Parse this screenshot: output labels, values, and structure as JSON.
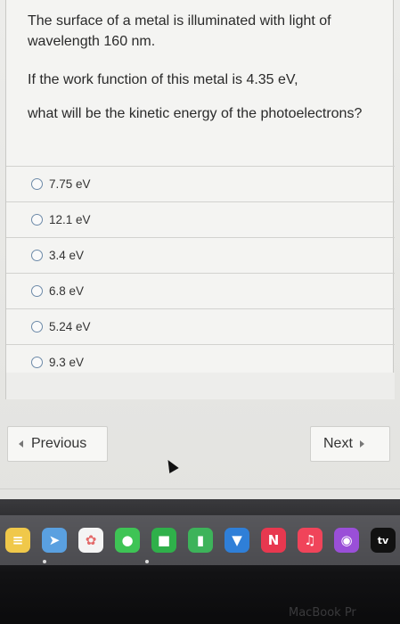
{
  "question": {
    "line1": "The surface of a metal is illuminated with light of wavelength 160 nm.",
    "line2": "If the work function of this metal is 4.35 eV,",
    "line3": "what will be the kinetic energy of the photoelectrons?"
  },
  "options": [
    {
      "label": "7.75 eV"
    },
    {
      "label": "12.1 eV"
    },
    {
      "label": "3.4 eV"
    },
    {
      "label": "6.8 eV"
    },
    {
      "label": "5.24 eV"
    },
    {
      "label": "9.3 eV"
    }
  ],
  "navigation": {
    "previous_label": "Previous",
    "next_label": "Next"
  },
  "dock": {
    "items": [
      {
        "icon": "notes-icon",
        "color": "#f0c84a"
      },
      {
        "icon": "maps-icon",
        "color": "#5aa0e0"
      },
      {
        "icon": "photos-icon",
        "color": "#e46a6a"
      },
      {
        "icon": "messages-icon",
        "color": "#3ec455"
      },
      {
        "icon": "facetime-icon",
        "color": "#2fb04a"
      },
      {
        "icon": "numbers-icon",
        "color": "#3db35a"
      },
      {
        "icon": "keynote-icon",
        "color": "#2f7fd8"
      },
      {
        "icon": "news-icon",
        "color": "#e8384f"
      },
      {
        "icon": "music-icon",
        "color": "#f0445a"
      },
      {
        "icon": "podcasts-icon",
        "color": "#9a4fd8"
      },
      {
        "icon": "appletv-icon",
        "color": "#111111"
      }
    ],
    "tv_label": "tv"
  },
  "device": {
    "brand": "MacBook Pr"
  }
}
